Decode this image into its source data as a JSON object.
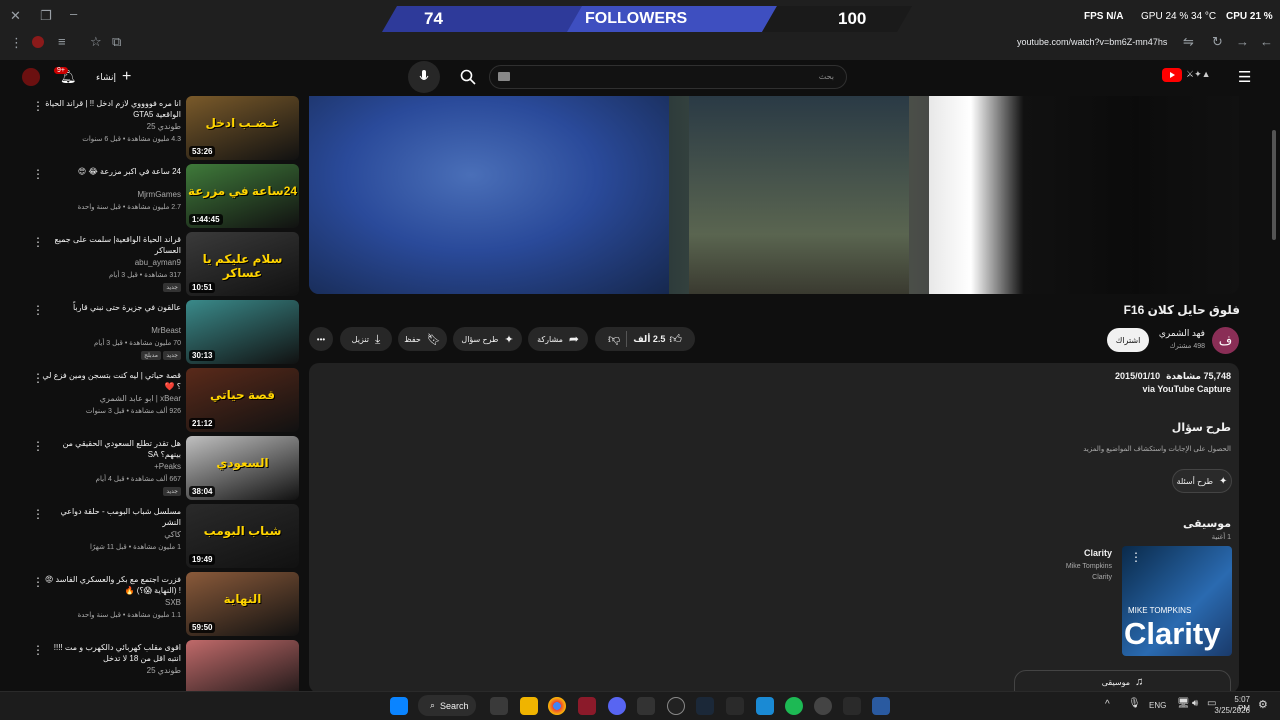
{
  "overlay": {
    "left_count": "74",
    "label": "FOLLOWERS",
    "right_count": "100"
  },
  "stats": {
    "fps_label": "FPS",
    "fps_value": "N/A",
    "gpu": "GPU 24 % 34 °C",
    "cpu": "CPU 21 %"
  },
  "browser": {
    "url": "youtube.com/watch?v=bm6Z-mn47hs"
  },
  "topbar": {
    "create_label": "إنشاء",
    "notif_badge": "9+",
    "search_placeholder": "بحث"
  },
  "recommendations": [
    {
      "title": "انا مره فووووي لازم ادخل !! | قراند الحياة الواقعية GTA5",
      "channel": "طوندي 25",
      "meta": "4.3 مليون مشاهدة • قبل 6 سنوات",
      "duration": "53:26",
      "thumb_text": "غـضـب ادخل",
      "thumb_color": "#7a5a2a"
    },
    {
      "title": "24 ساعة في اكبر مزرعة 😂 😍",
      "channel": "MjrmGames",
      "meta": "2.7 مليون مشاهدة • قبل سنة واحدة",
      "duration": "1:44:45",
      "thumb_text": "24ساعة في مزرعة",
      "thumb_color": "#3f7a3a"
    },
    {
      "title": "قراند الحياة الواقعية| سلمت على جميع العساكر",
      "channel": "abu_ayman9",
      "meta": "317 مشاهدة • قبل 3 أيام",
      "badge": "جديد",
      "duration": "10:51",
      "thumb_text": "سلام عليكم يا عساكر",
      "thumb_color": "#3a3a3a"
    },
    {
      "title": "عالقون في جزيرة حتى نبني قارباً",
      "channel": "MrBeast",
      "meta": "70 مليون مشاهدة • قبل 3 أيام",
      "badge": "جديد",
      "badge2": "مدبلج",
      "duration": "30:13",
      "thumb_text": "",
      "thumb_color": "#3a8a8a"
    },
    {
      "title": "قصة حياتي | ليه كنت بتسجن ومين فزع لي ؟ ❤️",
      "channel": "xBear | ابو عابد الشمري",
      "meta": "926 ألف مشاهدة • قبل 3 سنوات",
      "duration": "21:12",
      "thumb_text": "قصة حياتي",
      "thumb_color": "#5a2a1a"
    },
    {
      "title": "هل تقدر تطلع السعودي الحقيقي من بينهم؟ SA",
      "channel": "Peaks+",
      "meta": "667 ألف مشاهدة • قبل 4 أيام",
      "badge": "جديد",
      "duration": "38:04",
      "thumb_text": "السعودي",
      "thumb_color": "#c0c0c0"
    },
    {
      "title": "مسلسل شباب البومب - حلقة دواعي النشر",
      "channel": "كاكي",
      "meta": "1 مليون مشاهدة • قبل 11 شهرًا",
      "duration": "19:49",
      "thumb_text": "شباب البومب",
      "thumb_color": "#2a2a2a"
    },
    {
      "title": "فزرت اجتمع مع بكر والعسكري الفاسد 😡 ! (النهاية 😱؟) 🔥",
      "channel": "SXB",
      "meta": "1.1 مليون مشاهدة • قبل سنة واحدة",
      "duration": "59:50",
      "thumb_text": "النهاية",
      "thumb_color": "#8a5a3a"
    },
    {
      "title": "اقوى مقلب كهربائي دالكهرب و مت !!!! انتبه اقل من 18 لا تدخل",
      "channel": "طوندي 25",
      "meta": "",
      "duration": "",
      "thumb_text": "",
      "thumb_color": "#c06a6a"
    }
  ],
  "video": {
    "title": "فلوق حايل كلان F16",
    "channel_name": "فهد الشمري",
    "subs": "498 مشترك",
    "avatar_letter": "ف",
    "subscribe": "اشتراك",
    "likes": "2.5 ألف",
    "share": "مشاركة",
    "ask": "طرح سؤال",
    "save": "حفظ",
    "download": "تنزيل",
    "views": "75,748 مشاهدة",
    "date": "2015/01/10",
    "via": "via YouTube Capture"
  },
  "ask_section": {
    "title": "طرح سؤال",
    "desc": "الحصول على الإجابات واستكشاف المواضيع والمزيد",
    "button": "طرح أسئلة"
  },
  "music": {
    "title": "موسيقى",
    "count": "1 أغنية",
    "song": "Clarity",
    "artist": "Mike Tompkins",
    "album": "Clarity",
    "art_text": "Clarity",
    "art_artist": "MIKE TOMPKINS",
    "footer_button": "موسيقى"
  },
  "taskbar": {
    "search": "Search",
    "lang": "ENG",
    "time": "5:07 PM",
    "date": "3/25/2026"
  }
}
